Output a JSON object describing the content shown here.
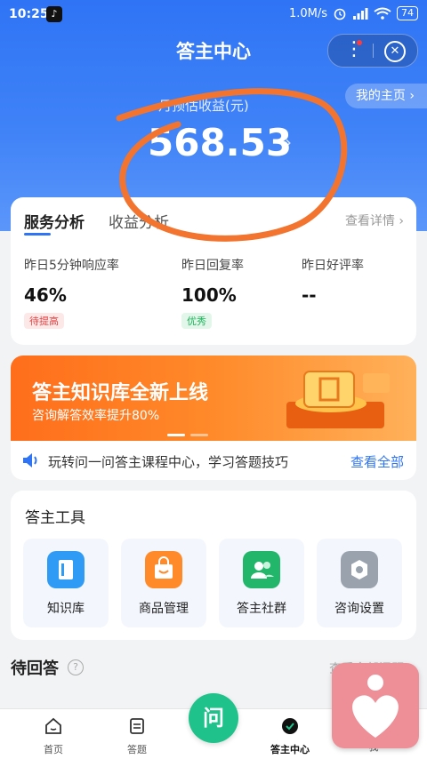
{
  "status_bar": {
    "time": "10:25",
    "tiktok_glyph": "♪",
    "speed": "1.0M/s",
    "battery": "74",
    "icons": [
      "alarm-icon",
      "signal-icon",
      "wifi-icon",
      "battery-icon"
    ]
  },
  "header": {
    "title": "答主中心",
    "my_homepage": "我的主页 ›",
    "estimated_label": "月预估收益(元)",
    "amount": "568.53",
    "amount_arrow": "›"
  },
  "analysis": {
    "tabs": [
      "服务分析",
      "收益分析"
    ],
    "details_link": "查看详情 ›",
    "metrics": [
      {
        "label": "昨日5分钟响应率",
        "value": "46%",
        "badge": "待提高"
      },
      {
        "label": "昨日回复率",
        "value": "100%",
        "badge": "优秀"
      },
      {
        "label": "昨日好评率",
        "value": "--",
        "badge": ""
      }
    ]
  },
  "banner": {
    "headline": "答主知识库全新上线",
    "sub": "咨询解答效率提升80%",
    "notice_text": "玩转问一问答主课程中心，学习答题技巧",
    "notice_link": "查看全部"
  },
  "tools": {
    "title": "答主工具",
    "items": [
      {
        "label": "知识库",
        "icon": "book-icon",
        "color": "#2f9bf5"
      },
      {
        "label": "商品管理",
        "icon": "shopping-bag-icon",
        "color": "#ff8a2a"
      },
      {
        "label": "答主社群",
        "icon": "group-icon",
        "color": "#22b66a"
      },
      {
        "label": "咨询设置",
        "icon": "settings-hex-icon",
        "color": "#9aa3ad"
      }
    ]
  },
  "pending": {
    "title": "待回答",
    "help_glyph": "?",
    "right_link": "查看全部问题 ›"
  },
  "tabbar": {
    "items": [
      "首页",
      "答题",
      "答主中心",
      "我"
    ],
    "center_glyph": "问",
    "active": "答主中心"
  },
  "colors": {
    "primary": "#2f74f5",
    "accent_green": "#1fc28a",
    "banner_orange": "#ff7a22",
    "annotation_orange": "#f2742e"
  }
}
